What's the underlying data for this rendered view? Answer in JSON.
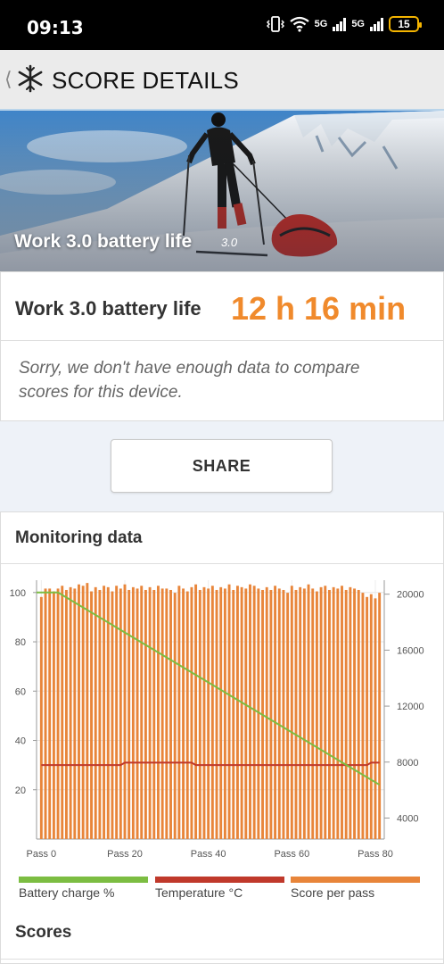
{
  "status_bar": {
    "time": "09:13",
    "network1": "5G",
    "network2": "5G",
    "battery": "15"
  },
  "app_bar": {
    "title": "SCORE DETAILS"
  },
  "hero": {
    "caption": "Work 3.0 battery life",
    "version": "3.0"
  },
  "result": {
    "label": "Work 3.0 battery life",
    "value": "12 h 16 min",
    "note": "Sorry, we don't have enough data to compare scores for this device."
  },
  "share_label": "SHARE",
  "monitoring": {
    "title": "Monitoring data",
    "scores_label": "Scores"
  },
  "colors": {
    "battery": "#7cbd42",
    "temperature": "#c0392b",
    "score": "#e8853a",
    "accent": "#f08a2c"
  },
  "chart_data": {
    "type": "bar",
    "x_tick_labels": [
      "Pass 0",
      "Pass 20",
      "Pass 40",
      "Pass 60",
      "Pass 80"
    ],
    "left_axis": {
      "ticks": [
        20,
        40,
        60,
        80,
        100
      ],
      "range": [
        0,
        105
      ]
    },
    "right_axis": {
      "ticks": [
        4000,
        8000,
        12000,
        16000,
        20000
      ],
      "range": [
        2500,
        21000
      ]
    },
    "grid": true,
    "legend_position": "bottom",
    "series": [
      {
        "name": "Battery charge %",
        "type": "line",
        "axis": "left",
        "color": "#7cbd42",
        "start": 100,
        "end": 22
      },
      {
        "name": "Temperature °C",
        "type": "line",
        "axis": "left",
        "color": "#c0392b",
        "values_approx": 30,
        "max": 31
      },
      {
        "name": "Score per pass",
        "type": "bar",
        "axis": "right",
        "color": "#e8853a",
        "values": [
          19800,
          20400,
          20400,
          20200,
          20400,
          20600,
          20300,
          20500,
          20400,
          20700,
          20600,
          20800,
          20200,
          20500,
          20300,
          20600,
          20500,
          20200,
          20600,
          20400,
          20700,
          20300,
          20500,
          20400,
          20600,
          20300,
          20500,
          20300,
          20600,
          20400,
          20400,
          20300,
          20100,
          20600,
          20400,
          20200,
          20500,
          20700,
          20300,
          20500,
          20400,
          20600,
          20300,
          20500,
          20400,
          20700,
          20300,
          20600,
          20500,
          20400,
          20700,
          20600,
          20400,
          20300,
          20500,
          20300,
          20600,
          20400,
          20300,
          20100,
          20600,
          20300,
          20500,
          20400,
          20700,
          20400,
          20200,
          20500,
          20600,
          20300,
          20500,
          20400,
          20600,
          20300,
          20500,
          20400,
          20300,
          20100,
          19800,
          20000,
          19700,
          20100
        ]
      }
    ]
  }
}
